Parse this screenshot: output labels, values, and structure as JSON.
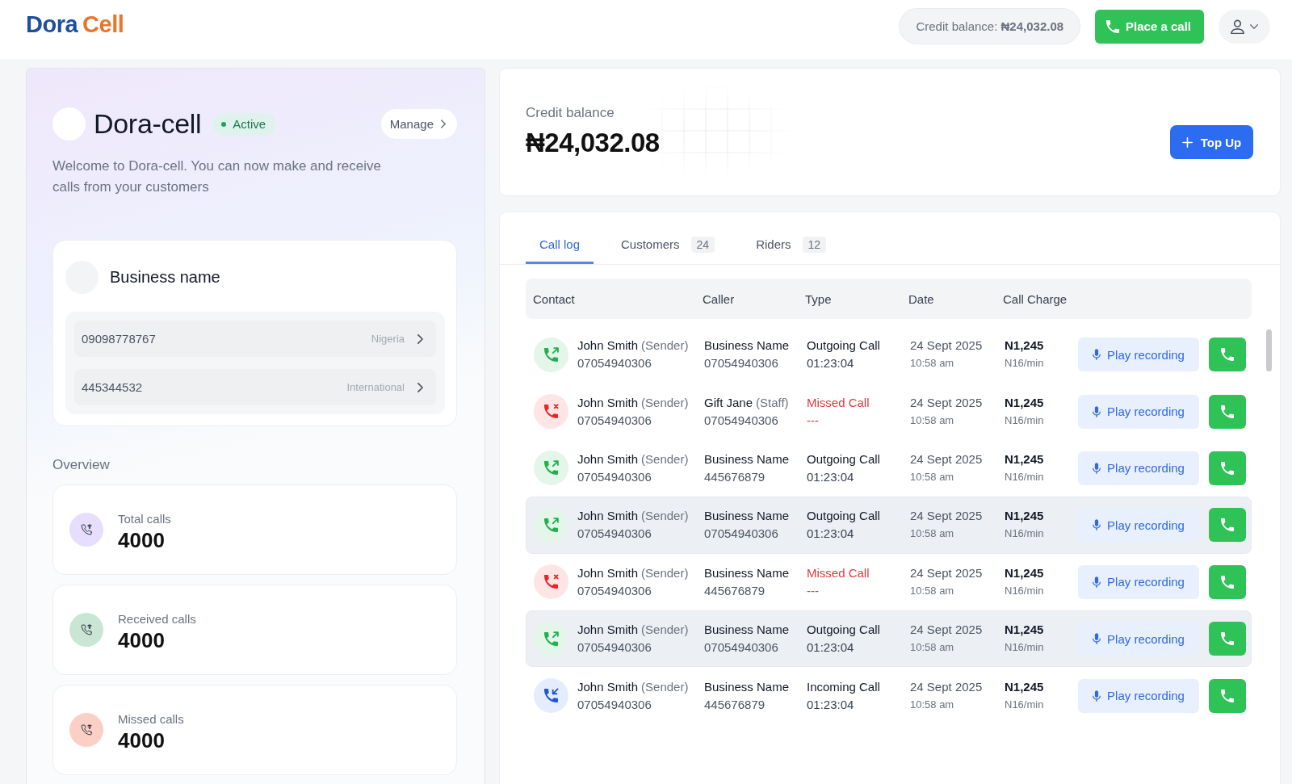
{
  "header": {
    "logo": [
      {
        "text": "Dora",
        "color": "#1d4f9f"
      },
      {
        "text": "Cell",
        "color": "#e5762c"
      }
    ],
    "credit_pill": "Credit balance: **₦24,032.08**",
    "place_call_button": "Place a call"
  },
  "profile": {
    "name": "Dora-cell",
    "status": "Active",
    "manage_button": "Manage",
    "welcome": "Welcome to Dora-cell. You can now make and receive calls from your customers"
  },
  "business": {
    "name": "Business name",
    "numbers": [
      {
        "number": "09098778767",
        "region": "Nigeria"
      },
      {
        "number": "445344532",
        "region": "International"
      }
    ]
  },
  "overview": {
    "title": "Overview",
    "stats": [
      {
        "label": "Total calls",
        "value": "4000",
        "color": "#e6defc"
      },
      {
        "label": "Received calls",
        "value": "4000",
        "color": "#c9e6d4"
      },
      {
        "label": "Missed calls",
        "value": "4000",
        "color": "#fccfc6"
      }
    ]
  },
  "balance_card": {
    "label": "Credit balance",
    "amount": "₦24,032.08",
    "top_up_button": "Top Up"
  },
  "tabs": [
    {
      "label": "Call log",
      "selected": true
    },
    {
      "label": "Customers",
      "count": "24",
      "selected": false
    },
    {
      "label": "Riders",
      "count": "12",
      "selected": false
    }
  ],
  "table": {
    "columns": [
      "Contact",
      "Caller",
      "Type",
      "Date",
      "Call Charge"
    ],
    "rows": [
      {
        "kind": "outgoing",
        "contact": "John Smith",
        "contact_role": "(Sender)",
        "contact_number": "07054940306",
        "caller": "Business Name",
        "caller_number": "07054940306",
        "type": "Outgoing Call",
        "duration": "01:23:04",
        "date": "24 Sept 2025",
        "time": "10:58 am",
        "charge": "N1,245",
        "rate": "N16/min",
        "play_button": "Play recording",
        "highlighted": false
      },
      {
        "kind": "missed",
        "contact": "John Smith",
        "contact_role": "(Sender)",
        "contact_number": "07054940306",
        "caller": "Gift Jane",
        "caller_role": "(Staff)",
        "caller_number": "07054940306",
        "type": "Missed Call",
        "duration": "---",
        "date": "24 Sept 2025",
        "time": "10:58 am",
        "charge": "N1,245",
        "rate": "N16/min",
        "play_button": "Play recording",
        "highlighted": false
      },
      {
        "kind": "outgoing",
        "contact": "John Smith",
        "contact_role": "(Sender)",
        "contact_number": "07054940306",
        "caller": "Business Name",
        "caller_number": "445676879",
        "type": "Outgoing Call",
        "duration": "01:23:04",
        "date": "24 Sept 2025",
        "time": "10:58 am",
        "charge": "N1,245",
        "rate": "N16/min",
        "play_button": "Play recording",
        "highlighted": false
      },
      {
        "kind": "outgoing",
        "contact": "John Smith",
        "contact_role": "(Sender)",
        "contact_number": "07054940306",
        "caller": "Business Name",
        "caller_number": "07054940306",
        "type": "Outgoing Call",
        "duration": "01:23:04",
        "date": "24 Sept 2025",
        "time": "10:58 am",
        "charge": "N1,245",
        "rate": "N16/min",
        "play_button": "Play recording",
        "highlighted": true
      },
      {
        "kind": "missed",
        "contact": "John Smith",
        "contact_role": "(Sender)",
        "contact_number": "07054940306",
        "caller": "Business Name",
        "caller_number": "445676879",
        "type": "Missed Call",
        "duration": "---",
        "date": "24 Sept 2025",
        "time": "10:58 am",
        "charge": "N1,245",
        "rate": "N16/min",
        "play_button": "Play recording",
        "highlighted": false
      },
      {
        "kind": "outgoing",
        "contact": "John Smith",
        "contact_role": "(Sender)",
        "contact_number": "07054940306",
        "caller": "Business Name",
        "caller_number": "07054940306",
        "type": "Outgoing Call",
        "duration": "01:23:04",
        "date": "24 Sept 2025",
        "time": "10:58 am",
        "charge": "N1,245",
        "rate": "N16/min",
        "play_button": "Play recording",
        "highlighted": true
      },
      {
        "kind": "incoming",
        "contact": "John Smith",
        "contact_role": "(Sender)",
        "contact_number": "07054940306",
        "caller": "Business Name",
        "caller_number": "445676879",
        "type": "Incoming Call",
        "duration": "01:23:04",
        "date": "24 Sept 2025",
        "time": "10:58 am",
        "charge": "N1,245",
        "rate": "N16/min",
        "play_button": "Play recording",
        "highlighted": false
      }
    ]
  }
}
